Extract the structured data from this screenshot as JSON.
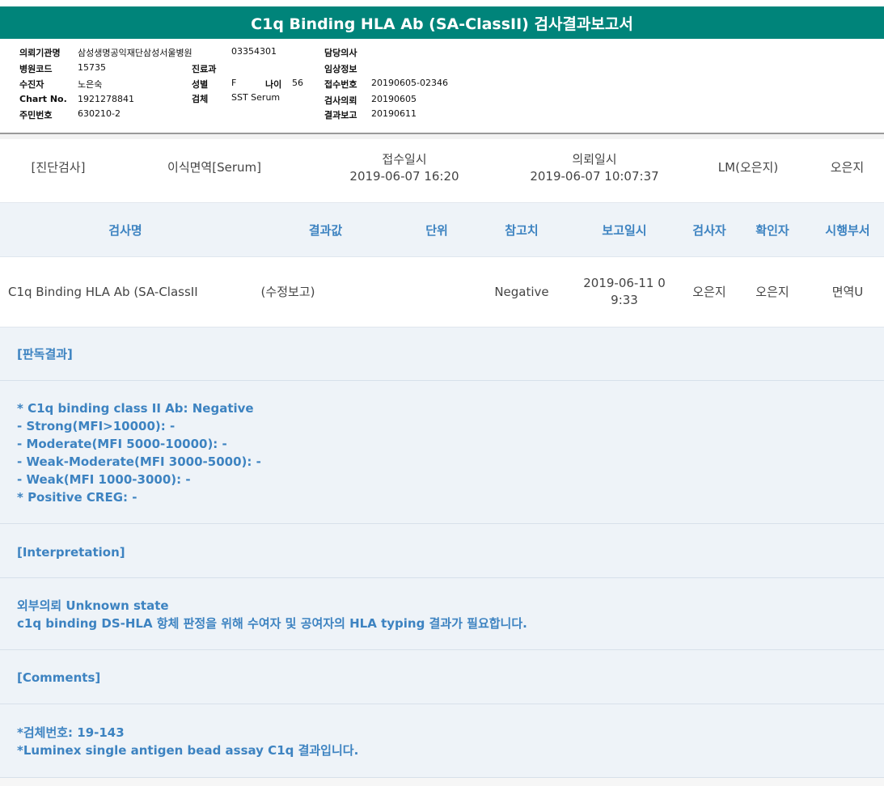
{
  "title": "C1q Binding HLA Ab (SA-ClassII) 검사결과보고서",
  "patient_info": {
    "requesting_institution_label": "의뢰기관명",
    "requesting_institution": "삼성생명공익재단삼성서울병원",
    "institution_code_value": "03354301",
    "attending_physician_label": "담당의사",
    "hospital_code_label": "병원코드",
    "hospital_code": "15735",
    "department_label": "진료과",
    "clinical_info_label": "임상정보",
    "recipient_label": "수진자",
    "recipient": "노은숙",
    "sex_label": "성별",
    "sex": "F",
    "age_label": "나이",
    "age": "56",
    "receipt_no_label": "접수번호",
    "receipt_no": "20190605-02346",
    "chart_no_label": "Chart No.",
    "chart_no": "1921278841",
    "specimen_label": "검체",
    "specimen": "SST Serum",
    "test_request_label": "검사의뢰",
    "test_request": "20190605",
    "id_no_label": "주민번호",
    "id_no": "630210-2",
    "result_report_label": "결과보고",
    "result_report": "20190611"
  },
  "meta_row": {
    "category": "[진단검사]",
    "department": "이식면역[Serum]",
    "received_label": "접수일시",
    "received": "2019-06-07 16:20",
    "requested_label": "의뢰일시",
    "requested": "2019-06-07 10:07:37",
    "doctor": "LM(오은지)",
    "name": "오은지"
  },
  "table": {
    "headers": [
      "검사명",
      "결과값",
      "단위",
      "참고치",
      "보고일시",
      "검사자",
      "확인자",
      "시행부서"
    ],
    "row": {
      "test_name": "C1q Binding HLA Ab (SA-ClassII",
      "result": "(수정보고)",
      "unit": "",
      "reference": "Negative",
      "report_time_line1": "2019-06-11 0",
      "report_time_line2": "9:33",
      "tester": "오은지",
      "confirmer": "오은지",
      "dept": "면역U"
    }
  },
  "sections": {
    "reading_title": "[판독결과]",
    "reading_lines": [
      "* C1q binding class II Ab: Negative",
      "- Strong(MFI>10000): -",
      "- Moderate(MFI 5000-10000): -",
      "- Weak-Moderate(MFI 3000-5000): -",
      "- Weak(MFI 1000-3000): -",
      "* Positive CREG: -"
    ],
    "interpretation_title": "[Interpretation]",
    "interpretation_lines": [
      "외부의뢰 Unknown state",
      "c1q binding  DS-HLA 항체 판정을 위해 수여자 및 공여자의 HLA typing 결과가 필요합니다."
    ],
    "comments_title": "[Comments]",
    "comments_lines": [
      "*검체번호: 19-143",
      "*Luminex single antigen bead assay C1q 결과입니다."
    ]
  }
}
